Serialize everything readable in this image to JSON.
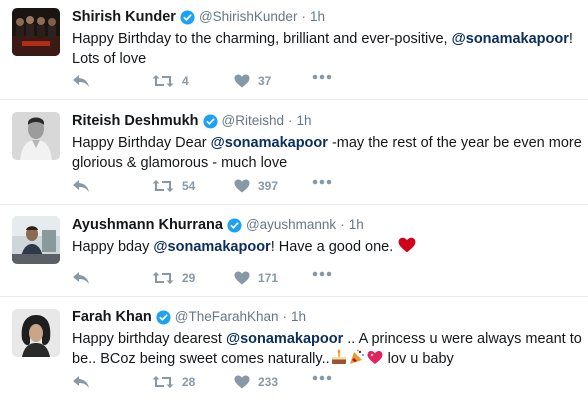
{
  "tweets": [
    {
      "name": "Shirish Kunder",
      "handle": "@ShirishKunder",
      "time": "1h",
      "line1_a": "Happy Birthday to the charming, brilliant and ever-positive, ",
      "line1_mention": "@sonamakapoor",
      "line1_b": "!",
      "line2": "Lots of love",
      "retweets": "4",
      "likes": "37"
    },
    {
      "name": "Riteish Deshmukh",
      "handle": "@Riteishd",
      "time": "1h",
      "line1_a": "Happy Birthday Dear ",
      "line1_mention": "@sonamakapoor",
      "line1_b": " -may the rest of the year be even more",
      "line2": "glorious & glamorous - much love",
      "retweets": "54",
      "likes": "397"
    },
    {
      "name": "Ayushmann Khurrana",
      "handle": "@ayushmannk",
      "time": "1h",
      "line1_a": "Happy bday ",
      "line1_mention": "@sonamakapoor",
      "line1_b": "! Have a good one. ",
      "retweets": "29",
      "likes": "171"
    },
    {
      "name": "Farah Khan",
      "handle": "@TheFarahKhan",
      "time": "1h",
      "line1_a": "Happy birthday dearest ",
      "line1_mention": "@sonamakapoor",
      "line1_b": " .. A princess u were always meant to",
      "line2_a": "be.. BCoz being sweet comes naturally..",
      "line2_b": " lov u baby",
      "retweets": "28",
      "likes": "233"
    }
  ],
  "icons": {
    "reply": "reply-icon",
    "retweet": "retweet-icon",
    "like": "heart-icon",
    "more": "more-icon",
    "verified": "verified-badge-icon"
  },
  "colors": {
    "verified": "#1da1f2",
    "mention": "#0a2e5c",
    "muted": "#8899a6",
    "heart_emoji": "#e0245e"
  }
}
